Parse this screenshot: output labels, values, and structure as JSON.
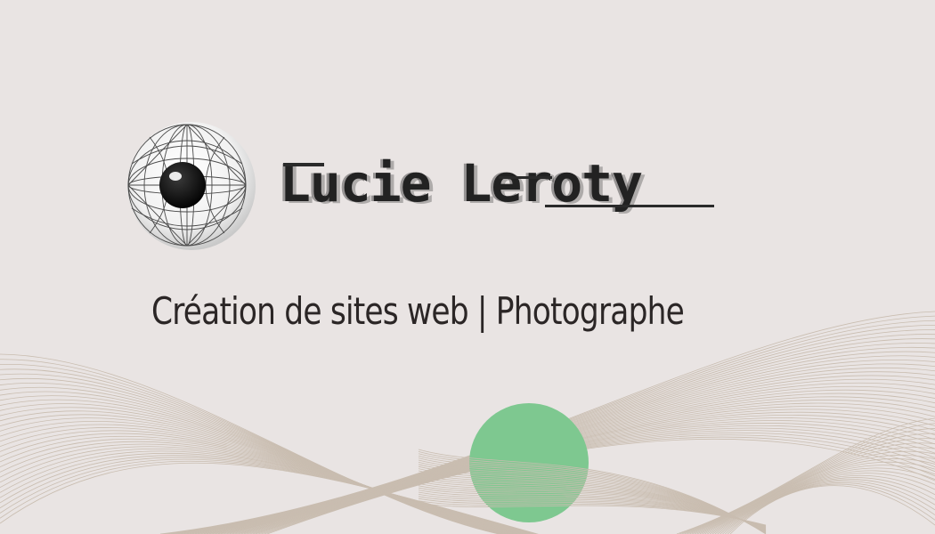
{
  "brand": {
    "name": "Lucie Leroty",
    "logo_icon": "eye-globe-icon"
  },
  "tagline": "Création de sites web | Photographe",
  "colors": {
    "background": "#e9e4e3",
    "wave_lines": "#c9bdb0",
    "accent_circle": "#7ec890",
    "text": "#2b2626"
  }
}
